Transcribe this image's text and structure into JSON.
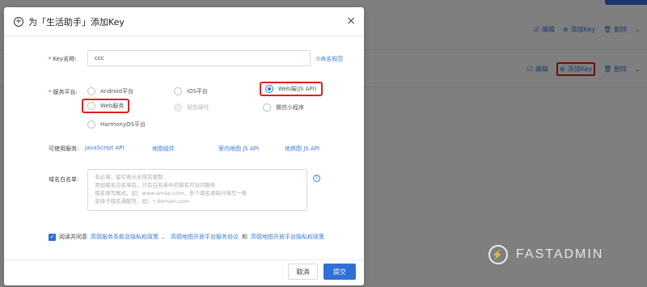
{
  "background": {
    "rows": [
      {
        "actions": [
          {
            "icon": "edit-icon",
            "glyph": "☑",
            "label": "编辑"
          },
          {
            "icon": "add-circle-icon",
            "glyph": "⊕",
            "label": "添加Key"
          },
          {
            "icon": "trash-icon",
            "glyph": "🗑",
            "label": "删除"
          }
        ]
      },
      {
        "actions": [
          {
            "icon": "edit-icon",
            "glyph": "☑",
            "label": "编辑"
          },
          {
            "icon": "add-circle-icon",
            "glyph": "⊕",
            "label": "添加Key"
          },
          {
            "icon": "trash-icon",
            "glyph": "🗑",
            "label": "删除"
          }
        ]
      }
    ],
    "chevron": "⌄",
    "watermark": "FASTADMIN",
    "watermark_icon": "⚡"
  },
  "modal": {
    "title": "为「生活助手」添加Key",
    "title_icon": "+",
    "close": "×",
    "key_name": {
      "label": "Key名称:",
      "value": "ccc",
      "help_link": "⑦命名规范"
    },
    "platform": {
      "label": "服务平台:",
      "options": [
        {
          "label": "Android平台",
          "checked": false,
          "disabled": false
        },
        {
          "label": "iOS平台",
          "checked": false,
          "disabled": false
        },
        {
          "label": "Web端(JS API)",
          "checked": true,
          "disabled": false
        },
        {
          "label": "Web服务",
          "checked": false,
          "disabled": false
        },
        {
          "label": "智能硬件",
          "checked": false,
          "disabled": true
        },
        {
          "label": "微信小程序",
          "checked": false,
          "disabled": false
        },
        {
          "label": "HarmonyOS平台",
          "checked": false,
          "disabled": false
        }
      ]
    },
    "services": {
      "label": "可使用服务:",
      "links": [
        "JavaScript API",
        "地图组件",
        "室内地图 JS API",
        "地铁图 JS API"
      ]
    },
    "whitelist": {
      "label": "域名白名单:",
      "placeholder_lines": [
        "非必填，留空表示无域名限制",
        "添加域名白名单后，只有白名单中的域名可访问服务",
        "域名填写格式，如：www.amap.com，多个域名请每行填写一条",
        "支持子域名通配符，如：*.domain.com"
      ],
      "help": "?"
    },
    "agreement": {
      "check": "✓",
      "prefix": "阅读并同意",
      "link1": "高德服务条款及隐私权政策",
      "sep1": "、",
      "link2": "高德地图开放平台服务协议",
      "sep2": " 和 ",
      "link3": "高德地图开放平台隐私权政策"
    },
    "buttons": {
      "cancel": "取消",
      "submit": "提交"
    }
  },
  "colors": {
    "accent": "#2f6fd8",
    "highlight": "#e02020"
  }
}
